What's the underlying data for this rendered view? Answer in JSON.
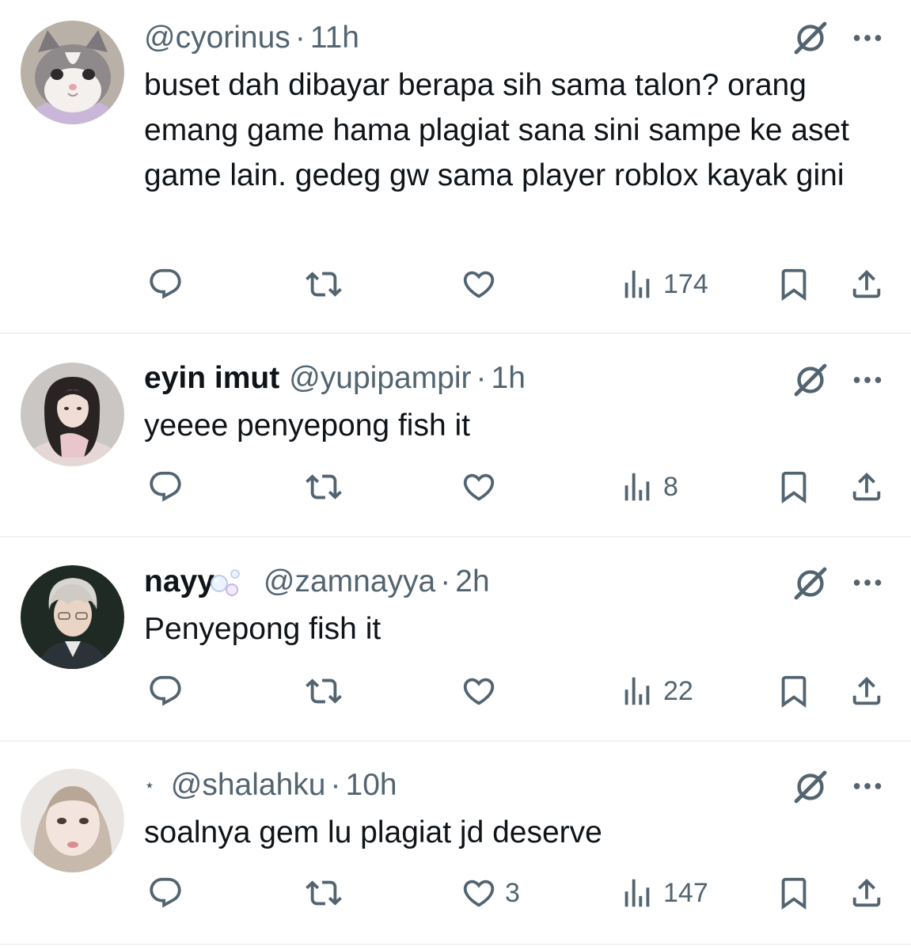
{
  "replies": [
    {
      "display_name": "",
      "handle": "@cyorinus",
      "separator": "·",
      "time": "11h",
      "avatar_icon": "cat-avatar",
      "text": "buset dah dibayar berapa sih sama talon? orang emang game hama plagiat sana sini sampe ke aset game lain. gedeg gw sama player roblox kayak gini",
      "replies_count": "",
      "reposts_count": "",
      "likes_count": "",
      "views_count": "174"
    },
    {
      "display_name": "eyin imut",
      "handle": "@yupipampir",
      "separator": "·",
      "time": "1h",
      "avatar_icon": "girl-avatar",
      "text": "yeeee penyepong fish it",
      "replies_count": "",
      "reposts_count": "",
      "likes_count": "",
      "views_count": "8"
    },
    {
      "display_name": "nayy",
      "handle": "@zamnayya",
      "separator": "·",
      "time": "2h",
      "avatar_icon": "boy-avatar",
      "name_emoji": "bubbles-emoji",
      "text": "Penyepong fish it",
      "replies_count": "",
      "reposts_count": "",
      "likes_count": "",
      "views_count": "22"
    },
    {
      "display_name": "",
      "name_prefix": "⋆",
      "handle": "@shalahku",
      "separator": "·",
      "time": "10h",
      "avatar_icon": "face-avatar",
      "text": "soalnya gem lu plagiat jd deserve",
      "replies_count": "",
      "reposts_count": "",
      "likes_count": "3",
      "views_count": "147"
    }
  ],
  "colors": {
    "icon_gray": "#536471",
    "text": "#0f1419",
    "divider": "#eff3f4"
  }
}
